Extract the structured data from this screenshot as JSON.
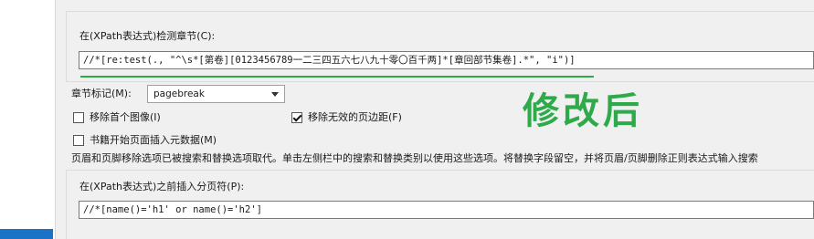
{
  "detect_chapters": {
    "label": "在(XPath表达式)检测章节(C):",
    "value": "//*[re:test(., \"^\\s*[第卷][0123456789一二三四五六七八九十零〇百千两]*[章回部节集卷].*\", \"i\")]"
  },
  "chapter_mark": {
    "label": "章节标记(M):",
    "value": "pagebreak"
  },
  "options": {
    "remove_first_image": {
      "label": "移除首个图像(I)",
      "checked": false
    },
    "remove_fake_margins": {
      "label": "移除无效的页边距(F)",
      "checked": true
    },
    "insert_metadata": {
      "label": "书籍开始页面插入元数据(M)",
      "checked": false
    }
  },
  "notice": "页眉和页脚移除选项已被搜索和替换选项取代。单击左侧栏中的搜索和替换类别以使用这些选项。将替换字段留空，并将页眉/页脚删除正则表达式输入搜索",
  "insert_pagebreak": {
    "label": "在(XPath表达式)之前插入分页符(P):",
    "value": "//*[name()='h1' or name()='h2']"
  },
  "annotation": {
    "text": "修改后",
    "color": "#2eaa4a"
  },
  "colors": {
    "accent_green": "#2eaa4a",
    "selection_blue": "#1a73c7"
  }
}
